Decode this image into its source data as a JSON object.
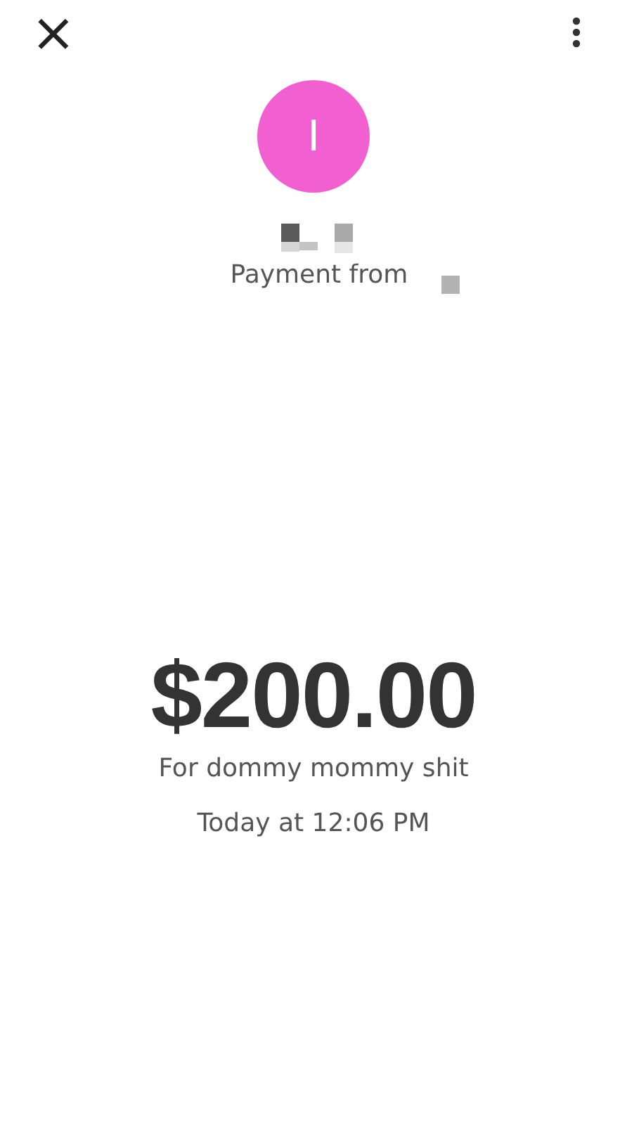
{
  "header": {
    "close": "×"
  },
  "sender": {
    "initial": "I",
    "color": "#f25fd0"
  },
  "caption": "Payment from",
  "amount": "$200.00",
  "note": "For dommy mommy shit",
  "time": "Today at 12:06 PM"
}
